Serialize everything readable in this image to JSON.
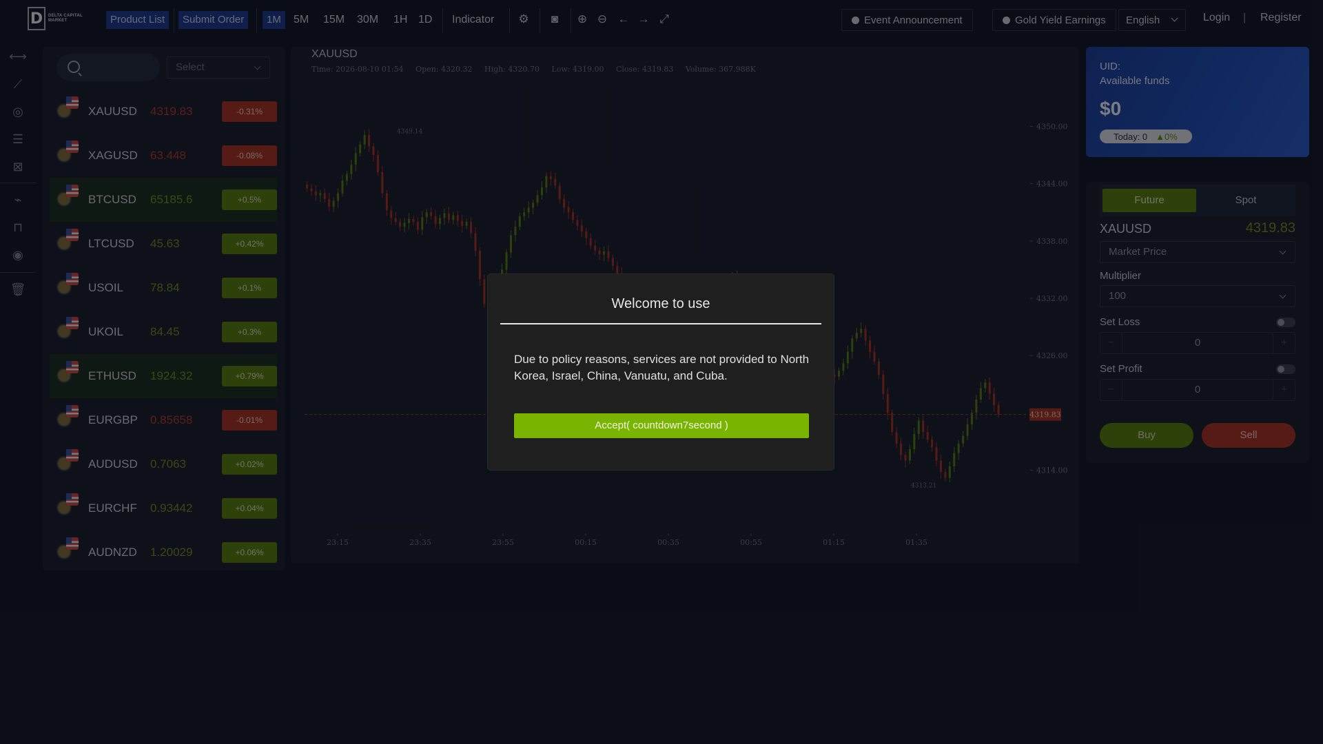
{
  "header": {
    "logo_text": "DELTA CAPITAL MARKET",
    "product_list": "Product List",
    "submit_order": "Submit Order",
    "intervals": [
      "1M",
      "5M",
      "15M",
      "30M",
      "1H",
      "1D"
    ],
    "active_interval": "1M",
    "indicator": "Indicator",
    "event_announcement": "Event Announcement",
    "gold_yield": "Gold Yield Earnings",
    "language": "English",
    "login": "Login",
    "divider": "|",
    "register": "Register"
  },
  "products": {
    "search_placeholder": "",
    "select_label": "Select",
    "items": [
      {
        "symbol": "XAUUSD",
        "price": "4319.83",
        "change": "-0.31%",
        "dir": "down",
        "highlight": false
      },
      {
        "symbol": "XAGUSD",
        "price": "63.448",
        "change": "-0.08%",
        "dir": "down",
        "highlight": false
      },
      {
        "symbol": "BTCUSD",
        "price": "65185.6",
        "change": "+0.5%",
        "dir": "up",
        "highlight": true
      },
      {
        "symbol": "LTCUSD",
        "price": "45.63",
        "change": "+0.42%",
        "dir": "up",
        "highlight": false
      },
      {
        "symbol": "USOIL",
        "price": "78.84",
        "change": "+0.1%",
        "dir": "up",
        "highlight": false
      },
      {
        "symbol": "UKOIL",
        "price": "84.45",
        "change": "+0.3%",
        "dir": "up",
        "highlight": false
      },
      {
        "symbol": "ETHUSD",
        "price": "1924.32",
        "change": "+0.79%",
        "dir": "up",
        "highlight": true
      },
      {
        "symbol": "EURGBP",
        "price": "0.85658",
        "change": "-0.01%",
        "dir": "down",
        "highlight": false
      },
      {
        "symbol": "AUDUSD",
        "price": "0.7063",
        "change": "+0.02%",
        "dir": "up",
        "highlight": false
      },
      {
        "symbol": "EURCHF",
        "price": "0.93442",
        "change": "+0.04%",
        "dir": "up",
        "highlight": false
      },
      {
        "symbol": "AUDNZD",
        "price": "1.20029",
        "change": "+0.06%",
        "dir": "up",
        "highlight": false
      }
    ]
  },
  "chart": {
    "title": "XAUUSD",
    "time": "Time: 2026-08-10 01:54",
    "open": "Open: 4320.32",
    "high": "High: 4320.70",
    "low": "Low: 4319.00",
    "close": "Close: 4319.83",
    "volume": "Volume: 367.988K"
  },
  "chart_data": {
    "type": "candlestick",
    "title": "XAUUSD",
    "y_ticks": [
      "4350.00",
      "4344.00",
      "4338.00",
      "4332.00",
      "4326.00",
      "4314.00"
    ],
    "x_ticks": [
      "23:15",
      "23:35",
      "23:55",
      "00:15",
      "00:35",
      "00:55",
      "01:15",
      "01:35"
    ],
    "ylim": [
      4310,
      4354
    ],
    "current_price": "4319.83",
    "max_label": "4349.14",
    "min_label": "4313.21",
    "up_color": "#5b7d14",
    "down_color": "#a8352a",
    "close_series": [
      4343.5,
      4343.2,
      4342.8,
      4343.0,
      4342.4,
      4341.6,
      4342.2,
      4343.0,
      4344.3,
      4345.0,
      4346.0,
      4347.2,
      4348.1,
      4349.1,
      4347.9,
      4347.0,
      4345.2,
      4343.0,
      4341.2,
      4340.4,
      4340.0,
      4339.5,
      4339.9,
      4340.3,
      4340.0,
      4339.2,
      4340.5,
      4341.0,
      4340.6,
      4339.8,
      4340.4,
      4340.9,
      4340.2,
      4340.7,
      4340.1,
      4339.6,
      4340.0,
      4338.8,
      4337.0,
      4334.0,
      4331.4,
      4331.0,
      4332.0,
      4333.5,
      4335.0,
      4336.8,
      4338.6,
      4339.5,
      4340.6,
      4341.0,
      4341.5,
      4342.0,
      4342.8,
      4343.6,
      4344.8,
      4344.5,
      4343.8,
      4342.4,
      4341.5,
      4341.0,
      4340.2,
      4339.6,
      4339.0,
      4338.3,
      4337.5,
      4337.0,
      4336.6,
      4336.9,
      4336.2,
      4335.4,
      4334.6,
      4333.8,
      4333.2,
      4332.6,
      4332.0,
      4331.6,
      4331.2,
      4330.8,
      4331.5,
      4332.0,
      4331.0,
      4330.6,
      4330.4,
      4330.8,
      4330.2,
      4330.9,
      4331.0,
      4330.8,
      4330.5,
      4330.2,
      4330.0,
      4329.4,
      4329.8,
      4330.4,
      4331.0,
      4333.5,
      4334.4,
      4333.0,
      4332.5,
      4331.8,
      4331.2,
      4330.6,
      4330.8,
      4331.0,
      4330.5,
      4330.0,
      4329.6,
      4328.8,
      4327.8,
      4327.0,
      4326.4,
      4325.8,
      4325.2,
      4325.5,
      4326.0,
      4325.6,
      4325.0,
      4324.6,
      4324.0,
      4323.8,
      4324.4,
      4325.2,
      4326.4,
      4327.8,
      4328.4,
      4328.8,
      4327.6,
      4326.4,
      4325.4,
      4324.0,
      4322.0,
      4320.0,
      4318.0,
      4316.8,
      4315.6,
      4315.0,
      4316.2,
      4317.8,
      4319.2,
      4318.0,
      4317.2,
      4316.4,
      4315.0,
      4313.8,
      4313.2,
      4314.4,
      4315.8,
      4316.8,
      4317.6,
      4318.8,
      4320.0,
      4321.4,
      4322.6,
      4323.2,
      4322.0,
      4320.8,
      4319.83
    ]
  },
  "funds": {
    "uid_label": "UID:",
    "available_label": "Available funds",
    "amount": "$0",
    "today": "Today: 0",
    "today_pct": "0%"
  },
  "order": {
    "tab_future": "Future",
    "tab_spot": "Spot",
    "symbol": "XAUUSD",
    "price": "4319.83",
    "order_type": "Market Price",
    "multiplier_label": "Multiplier",
    "multiplier_value": "100",
    "set_loss_label": "Set Loss",
    "set_loss_value": "0",
    "set_profit_label": "Set Profit",
    "set_profit_value": "0",
    "minus": "−",
    "plus": "+",
    "buy": "Buy",
    "sell": "Sell"
  },
  "modal": {
    "title": "Welcome to use",
    "body": "Due to policy reasons, services are not provided to North Korea, Israel, China, Vanuatu, and Cuba.",
    "accept": "Accept( countdown7second )"
  }
}
